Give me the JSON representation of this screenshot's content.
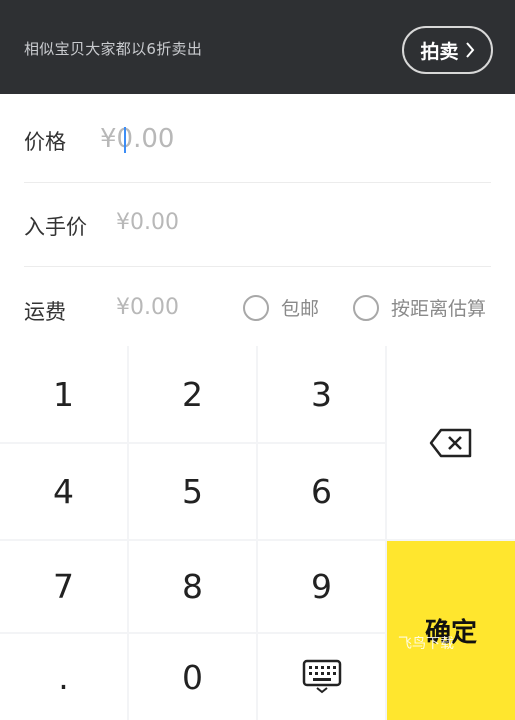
{
  "header": {
    "tip": "相似宝贝大家都以6折卖出",
    "auction_label": "拍卖"
  },
  "form": {
    "price": {
      "label": "价格",
      "placeholder": "¥0.00"
    },
    "purchase_price": {
      "label": "入手价",
      "placeholder": "¥0.00"
    },
    "shipping": {
      "label": "运费",
      "placeholder": "¥0.00",
      "options": [
        "包邮",
        "按距离估算"
      ]
    }
  },
  "keypad": {
    "keys": [
      "1",
      "2",
      "3",
      "4",
      "5",
      "6",
      "7",
      "8",
      "9",
      ".",
      "0"
    ],
    "confirm_label": "确定"
  },
  "watermark": "飞鸟下载"
}
